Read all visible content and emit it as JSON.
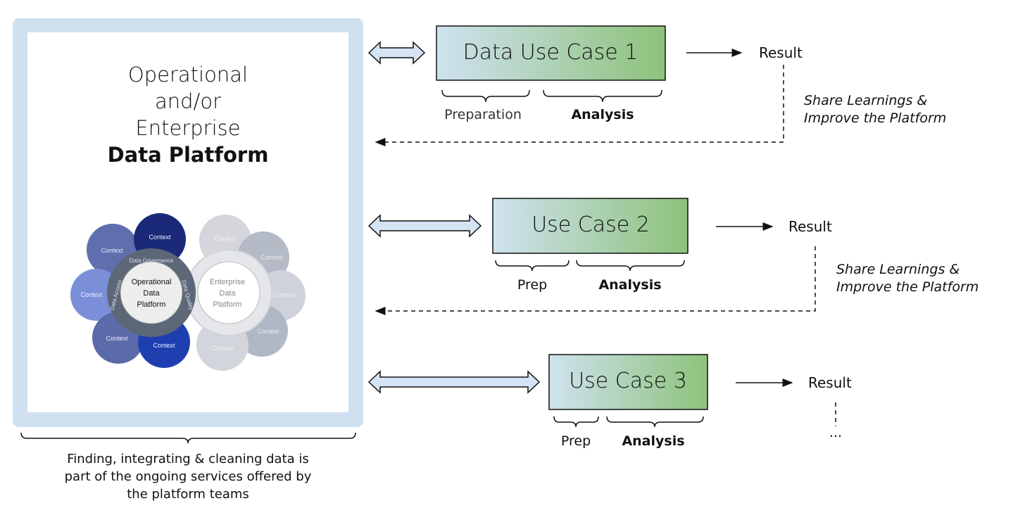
{
  "platform": {
    "title_lines": [
      "Operational",
      "and/or",
      "Enterprise"
    ],
    "title_bold": "Data Platform",
    "caption_lines": [
      "Finding, integrating & cleaning data is",
      "part of the ongoing services offered by",
      "the platform teams"
    ],
    "diagram": {
      "operational_center": "Operational Data Platform",
      "enterprise_center": "Enterprise Data Platform",
      "ring_labels": [
        "Data Governance",
        "Data Access",
        "Data Quality"
      ],
      "petal_label": "Context"
    }
  },
  "use_cases": [
    {
      "title": "Data Use Case  1",
      "prep_label": "Preparation",
      "analysis_label": "Analysis",
      "result": "Result",
      "feedback": [
        "Share Learnings &",
        "Improve the Platform"
      ]
    },
    {
      "title": "Use Case 2",
      "prep_label": "Prep",
      "analysis_label": "Analysis",
      "result": "Result",
      "feedback": [
        "Share Learnings &",
        "Improve the Platform"
      ]
    },
    {
      "title": "Use Case 3",
      "prep_label": "Prep",
      "analysis_label": "Analysis",
      "result": "Result",
      "continuation": "..."
    }
  ],
  "colors": {
    "panel": "#cfe0f1",
    "box_start": "#cfe2ef",
    "box_end": "#8dc27a",
    "arrow_fill": "#d5e4f4"
  }
}
